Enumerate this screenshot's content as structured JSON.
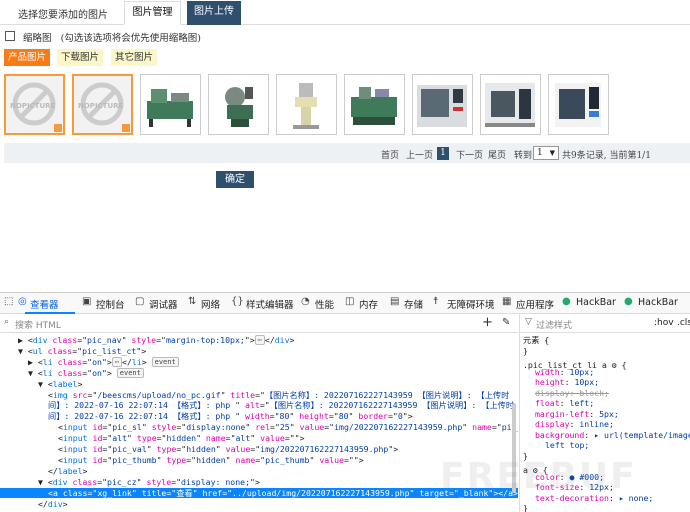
{
  "app": {
    "title": "选择您要添加的图片",
    "tabs": [
      "图片管理",
      "图片上传"
    ]
  },
  "options": {
    "thumbnail_label": "缩略图",
    "thumbnail_hint": "(勾选该选项将会优先使用缩略图)"
  },
  "categories": [
    "产品图片",
    "下载图片",
    "其它图片"
  ],
  "pager": {
    "first": "首页",
    "prev": "上一页",
    "current": "1",
    "next": "下一页",
    "last": "尾页",
    "goto": "转到",
    "select_value": "1",
    "summary": "共9条记录, 当前第1/1"
  },
  "confirm": "确定",
  "devtools": {
    "tabs": [
      "查看器",
      "控制台",
      "调试器",
      "网络",
      "样式编辑器",
      "性能",
      "内存",
      "存储",
      "无障碍环境",
      "应用程序",
      "HackBar",
      "HackBar"
    ],
    "search_placeholder": "搜索 HTML",
    "filter_placeholder": "过滤样式",
    "hov": ":hov",
    "cls": ".cls",
    "element_label": "元素",
    "html_lines": [
      {
        "indent": 1,
        "parts": [
          [
            "t",
            "▶ <"
          ],
          [
            "tag",
            "div"
          ],
          [
            "t",
            " "
          ],
          [
            "attr",
            "class"
          ],
          [
            "t",
            "=\""
          ],
          [
            "val",
            "pic_nav"
          ],
          [
            "t",
            "\" "
          ],
          [
            "attr",
            "style"
          ],
          [
            "t",
            "=\""
          ],
          [
            "val",
            "margin-top:10px;"
          ],
          [
            "t",
            "\">"
          ],
          [
            "badge",
            "⋯"
          ],
          [
            "t",
            "</"
          ],
          [
            "tag",
            "div"
          ],
          [
            "t",
            ">"
          ]
        ]
      },
      {
        "indent": 1,
        "parts": [
          [
            "t",
            "▼ <"
          ],
          [
            "tag",
            "ul"
          ],
          [
            "t",
            " "
          ],
          [
            "attr",
            "class"
          ],
          [
            "t",
            "=\""
          ],
          [
            "val",
            "pic_list_ct"
          ],
          [
            "t",
            "\">"
          ]
        ]
      },
      {
        "indent": 2,
        "parts": [
          [
            "t",
            "▶ <"
          ],
          [
            "tag",
            "li"
          ],
          [
            "t",
            " "
          ],
          [
            "attr",
            "class"
          ],
          [
            "t",
            "=\""
          ],
          [
            "val",
            "on"
          ],
          [
            "t",
            "\">"
          ],
          [
            "badge",
            "⋯"
          ],
          [
            "t",
            "</"
          ],
          [
            "tag",
            "li"
          ],
          [
            "t",
            "> "
          ],
          [
            "badge",
            "event"
          ]
        ]
      },
      {
        "indent": 2,
        "parts": [
          [
            "t",
            "▼ <"
          ],
          [
            "tag",
            "li"
          ],
          [
            "t",
            " "
          ],
          [
            "attr",
            "class"
          ],
          [
            "t",
            "=\""
          ],
          [
            "val",
            "on"
          ],
          [
            "t",
            "\"> "
          ],
          [
            "badge",
            "event"
          ]
        ]
      },
      {
        "indent": 3,
        "parts": [
          [
            "t",
            "▼ <"
          ],
          [
            "tag",
            "label"
          ],
          [
            "t",
            ">"
          ]
        ]
      },
      {
        "indent": 4,
        "parts": [
          [
            "t",
            "<"
          ],
          [
            "tag",
            "img"
          ],
          [
            "t",
            " "
          ],
          [
            "attr",
            "src"
          ],
          [
            "t",
            "=\""
          ],
          [
            "val",
            "/beescms/upload/no_pc.gif"
          ],
          [
            "t",
            "\" "
          ],
          [
            "attr",
            "title"
          ],
          [
            "t",
            "=\""
          ],
          [
            "val",
            "【图片名称】: 202207162227143959 【图片说明】: 【上传时"
          ],
          [
            "t",
            ""
          ]
        ]
      },
      {
        "indent": 4,
        "parts": [
          [
            "val",
            "间】: 2022-07-16 22:07:14 【格式】: php "
          ],
          [
            "t",
            "\" "
          ],
          [
            "attr",
            "alt"
          ],
          [
            "t",
            "=\""
          ],
          [
            "val",
            "【图片名称】: 202207162227143959 【图片说明】: 【上传时"
          ]
        ]
      },
      {
        "indent": 4,
        "parts": [
          [
            "val",
            "间】: 2022-07-16 22:07:14 【格式】: php "
          ],
          [
            "t",
            "\" "
          ],
          [
            "attr",
            "width"
          ],
          [
            "t",
            "=\""
          ],
          [
            "val",
            "80"
          ],
          [
            "t",
            "\" "
          ],
          [
            "attr",
            "height"
          ],
          [
            "t",
            "=\""
          ],
          [
            "val",
            "80"
          ],
          [
            "t",
            "\" "
          ],
          [
            "attr",
            "border"
          ],
          [
            "t",
            "=\""
          ],
          [
            "val",
            "0"
          ],
          [
            "t",
            "\">"
          ]
        ]
      },
      {
        "indent": 5,
        "parts": [
          [
            "t",
            "<"
          ],
          [
            "tag",
            "input"
          ],
          [
            "t",
            " "
          ],
          [
            "attr",
            "id"
          ],
          [
            "t",
            "=\""
          ],
          [
            "val",
            "pic_sl"
          ],
          [
            "t",
            "\" "
          ],
          [
            "attr",
            "style"
          ],
          [
            "t",
            "=\""
          ],
          [
            "val",
            "display:none"
          ],
          [
            "t",
            "\" "
          ],
          [
            "attr",
            "rel"
          ],
          [
            "t",
            "=\""
          ],
          [
            "val",
            "25"
          ],
          [
            "t",
            "\" "
          ],
          [
            "attr",
            "value"
          ],
          [
            "t",
            "=\""
          ],
          [
            "val",
            "img/202207162227143959.php"
          ],
          [
            "t",
            "\" "
          ],
          [
            "attr",
            "name"
          ],
          [
            "t",
            "=\""
          ],
          [
            "val",
            "pic_sl"
          ],
          [
            "t",
            "\">"
          ]
        ]
      },
      {
        "indent": 5,
        "parts": [
          [
            "t",
            "<"
          ],
          [
            "tag",
            "input"
          ],
          [
            "t",
            " "
          ],
          [
            "attr",
            "id"
          ],
          [
            "t",
            "=\""
          ],
          [
            "val",
            "alt"
          ],
          [
            "t",
            "\" "
          ],
          [
            "attr",
            "type"
          ],
          [
            "t",
            "=\""
          ],
          [
            "val",
            "hidden"
          ],
          [
            "t",
            "\" "
          ],
          [
            "attr",
            "name"
          ],
          [
            "t",
            "=\""
          ],
          [
            "val",
            "alt"
          ],
          [
            "t",
            "\" "
          ],
          [
            "attr",
            "value"
          ],
          [
            "t",
            "=\"\">"
          ]
        ]
      },
      {
        "indent": 5,
        "parts": [
          [
            "t",
            "<"
          ],
          [
            "tag",
            "input"
          ],
          [
            "t",
            " "
          ],
          [
            "attr",
            "id"
          ],
          [
            "t",
            "=\""
          ],
          [
            "val",
            "pic_val"
          ],
          [
            "t",
            "\" "
          ],
          [
            "attr",
            "type"
          ],
          [
            "t",
            "=\""
          ],
          [
            "val",
            "hidden"
          ],
          [
            "t",
            "\" "
          ],
          [
            "attr",
            "value"
          ],
          [
            "t",
            "=\""
          ],
          [
            "val",
            "img/202207162227143959.php"
          ],
          [
            "t",
            "\">"
          ]
        ]
      },
      {
        "indent": 5,
        "parts": [
          [
            "t",
            "<"
          ],
          [
            "tag",
            "input"
          ],
          [
            "t",
            " "
          ],
          [
            "attr",
            "id"
          ],
          [
            "t",
            "=\""
          ],
          [
            "val",
            "pic_thumb"
          ],
          [
            "t",
            "\" "
          ],
          [
            "attr",
            "type"
          ],
          [
            "t",
            "=\""
          ],
          [
            "val",
            "hidden"
          ],
          [
            "t",
            "\" "
          ],
          [
            "attr",
            "name"
          ],
          [
            "t",
            "=\""
          ],
          [
            "val",
            "pic_thumb"
          ],
          [
            "t",
            "\" "
          ],
          [
            "attr",
            "value"
          ],
          [
            "t",
            "=\"\">"
          ]
        ]
      },
      {
        "indent": 4,
        "parts": [
          [
            "t",
            "</"
          ],
          [
            "tag",
            "label"
          ],
          [
            "t",
            ">"
          ]
        ]
      },
      {
        "indent": 3,
        "parts": [
          [
            "t",
            "▼ <"
          ],
          [
            "tag",
            "div"
          ],
          [
            "t",
            " "
          ],
          [
            "attr",
            "class"
          ],
          [
            "t",
            "=\""
          ],
          [
            "val",
            "pic_cz"
          ],
          [
            "t",
            "\" "
          ],
          [
            "attr",
            "style"
          ],
          [
            "t",
            "=\""
          ],
          [
            "val",
            "display: none;"
          ],
          [
            "t",
            "\">"
          ]
        ]
      },
      {
        "indent": 4,
        "selected": true,
        "parts": [
          [
            "t",
            "<"
          ],
          [
            "tag",
            "a"
          ],
          [
            "t",
            " "
          ],
          [
            "attr",
            "class"
          ],
          [
            "t",
            "=\""
          ],
          [
            "val",
            "xg_link"
          ],
          [
            "t",
            "\" "
          ],
          [
            "attr",
            "title"
          ],
          [
            "t",
            "=\""
          ],
          [
            "val",
            "查看"
          ],
          [
            "t",
            "\" "
          ],
          [
            "attr",
            "href"
          ],
          [
            "t",
            "=\""
          ],
          [
            "val",
            "../upload/img/202207162227143959.php"
          ],
          [
            "t",
            "\" "
          ],
          [
            "attr",
            "target"
          ],
          [
            "t",
            "=\""
          ],
          [
            "val",
            "_blank"
          ],
          [
            "t",
            "\"></"
          ],
          [
            "tag",
            "a"
          ],
          [
            "t",
            ">"
          ]
        ]
      },
      {
        "indent": 3,
        "parts": [
          [
            "t",
            "</"
          ],
          [
            "tag",
            "div"
          ],
          [
            "t",
            ">"
          ]
        ]
      }
    ],
    "rules": [
      {
        "kind": "plain",
        "text": "元素 { "
      },
      {
        "kind": "plain",
        "text": "}"
      },
      {
        "kind": "selector",
        "text": ".pic_list_ct li a"
      },
      {
        "kind": "decl",
        "prop": "width",
        "val": "10px;"
      },
      {
        "kind": "decl",
        "prop": "height",
        "val": "10px;"
      },
      {
        "kind": "decl",
        "prop": "display",
        "val": "block;",
        "strike": true
      },
      {
        "kind": "decl",
        "prop": "float",
        "val": "left;"
      },
      {
        "kind": "decl",
        "prop": "margin-left",
        "val": "5px;"
      },
      {
        "kind": "decl",
        "prop": "display",
        "val": "inline;"
      },
      {
        "kind": "decl",
        "prop": "background",
        "val": "▸ url(template/images/c…"
      },
      {
        "kind": "cont",
        "val": "left top;"
      },
      {
        "kind": "plain",
        "text": "}"
      },
      {
        "kind": "selector",
        "text": "a"
      },
      {
        "kind": "decl",
        "prop": "color",
        "val": "● #000;"
      },
      {
        "kind": "decl",
        "prop": "font-size",
        "val": "12px;"
      },
      {
        "kind": "decl",
        "prop": "text-decoration",
        "val": "▸ none;"
      },
      {
        "kind": "plain",
        "text": "}"
      }
    ]
  },
  "colors": {
    "accent_orange": "#f77b16",
    "nav_dark": "#2f4f6f",
    "devtools_select": "#0a84ff"
  }
}
